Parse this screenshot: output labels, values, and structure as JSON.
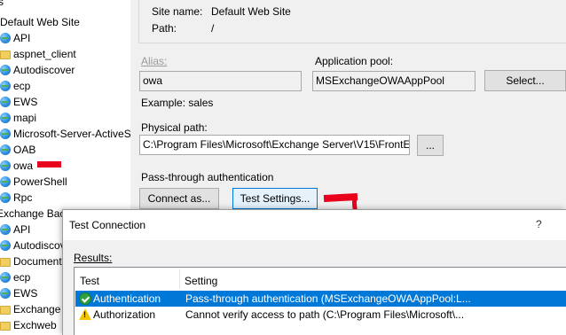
{
  "tree": {
    "items": [
      {
        "label": "s",
        "icon": "none"
      },
      {
        "label": "Default Web Site",
        "icon": "none"
      },
      {
        "label": "API",
        "icon": "globe"
      },
      {
        "label": "aspnet_client",
        "icon": "folder"
      },
      {
        "label": "Autodiscover",
        "icon": "globe"
      },
      {
        "label": "ecp",
        "icon": "globe"
      },
      {
        "label": "EWS",
        "icon": "globe"
      },
      {
        "label": "mapi",
        "icon": "globe"
      },
      {
        "label": "Microsoft-Server-ActiveSync",
        "icon": "globe"
      },
      {
        "label": "OAB",
        "icon": "globe"
      },
      {
        "label": "owa",
        "icon": "globe"
      },
      {
        "label": "PowerShell",
        "icon": "globe"
      },
      {
        "label": "Rpc",
        "icon": "globe"
      },
      {
        "label": "Exchange Back End",
        "icon": "none"
      },
      {
        "label": "API",
        "icon": "globe"
      },
      {
        "label": "Autodiscover",
        "icon": "globe"
      },
      {
        "label": "Documents",
        "icon": "folder"
      },
      {
        "label": "ecp",
        "icon": "globe"
      },
      {
        "label": "EWS",
        "icon": "globe"
      },
      {
        "label": "Exchange",
        "icon": "folder"
      },
      {
        "label": "Exchweb",
        "icon": "folder"
      }
    ]
  },
  "settings": {
    "site_name_label": "Site name:",
    "site_name_value": "Default Web Site",
    "path_label": "Path:",
    "path_value": "/",
    "alias_label": "Alias:",
    "alias_value": "owa",
    "app_pool_label": "Application pool:",
    "app_pool_value": "MSExchangeOWAAppPool",
    "select_button": "Select...",
    "example_text": "Example: sales",
    "physical_path_label": "Physical path:",
    "physical_path_value": "C:\\Program Files\\Microsoft\\Exchange Server\\V15\\FrontE",
    "browse_button": "...",
    "passthrough_label": "Pass-through authentication",
    "connect_as_button": "Connect as...",
    "test_settings_button": "Test Settings..."
  },
  "dialog": {
    "title": "Test Connection",
    "help": "?",
    "results_label": "Results:",
    "columns": [
      "Test",
      "Setting"
    ],
    "rows": [
      {
        "test": "Authentication",
        "setting": "Pass-through authentication (MSExchangeOWAAppPool:L...",
        "status": "ok-icon"
      },
      {
        "test": "Authorization",
        "setting": "Cannot verify access to path (C:\\Program Files\\Microsoft\\...",
        "status": "warning-icon"
      }
    ]
  },
  "colors": {
    "annotation_red": "#e8001c",
    "selection_blue": "#0078d7"
  }
}
